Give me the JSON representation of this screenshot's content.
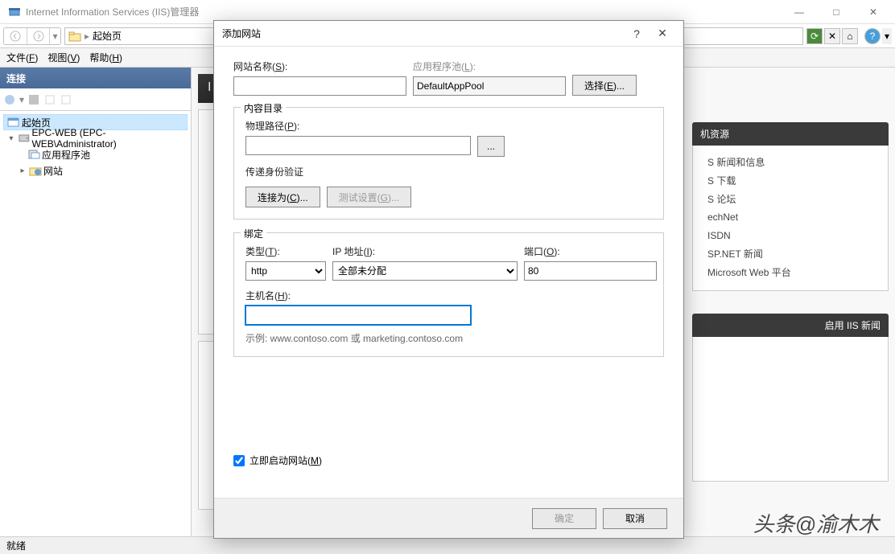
{
  "window": {
    "title": "Internet Information Services (IIS)管理器",
    "minimize": "—",
    "maximize": "□",
    "close": "✕"
  },
  "breadcrumb": {
    "home": "起始页"
  },
  "menu": {
    "file": "文件(F)",
    "view": "视图(V)",
    "help": "帮助(H)"
  },
  "sidebar": {
    "header": "连接",
    "tree": {
      "home": "起始页",
      "server": "EPC-WEB (EPC-WEB\\Administrator)",
      "app_pools": "应用程序池",
      "sites": "网站"
    }
  },
  "resources": {
    "header": "机资源",
    "items": [
      "S 新闻和信息",
      "S 下载",
      "S 论坛",
      "echNet",
      "ISDN",
      "SP.NET 新闻",
      "Microsoft Web 平台"
    ]
  },
  "news": {
    "header": "启用 IIS 新闻"
  },
  "statusbar": {
    "ready": "就绪"
  },
  "dialog": {
    "title": "添加网站",
    "help": "?",
    "close": "✕",
    "site_name_label": "网站名称(S):",
    "app_pool_label": "应用程序池(L):",
    "app_pool_value": "DefaultAppPool",
    "select_btn": "选择(E)...",
    "content_dir_legend": "内容目录",
    "physical_path_label": "物理路径(P):",
    "browse_btn": "...",
    "pass_auth_label": "传递身份验证",
    "connect_as_btn": "连接为(C)...",
    "test_settings_btn": "测试设置(G)...",
    "binding_legend": "绑定",
    "type_label": "类型(T):",
    "type_value": "http",
    "ip_label": "IP 地址(I):",
    "ip_value": "全部未分配",
    "port_label": "端口(O):",
    "port_value": "80",
    "hostname_label": "主机名(H):",
    "example": "示例: www.contoso.com 或 marketing.contoso.com",
    "start_immediately": "立即启动网站(M)",
    "ok": "确定",
    "cancel": "取消"
  },
  "watermark": "头条@渝木木"
}
